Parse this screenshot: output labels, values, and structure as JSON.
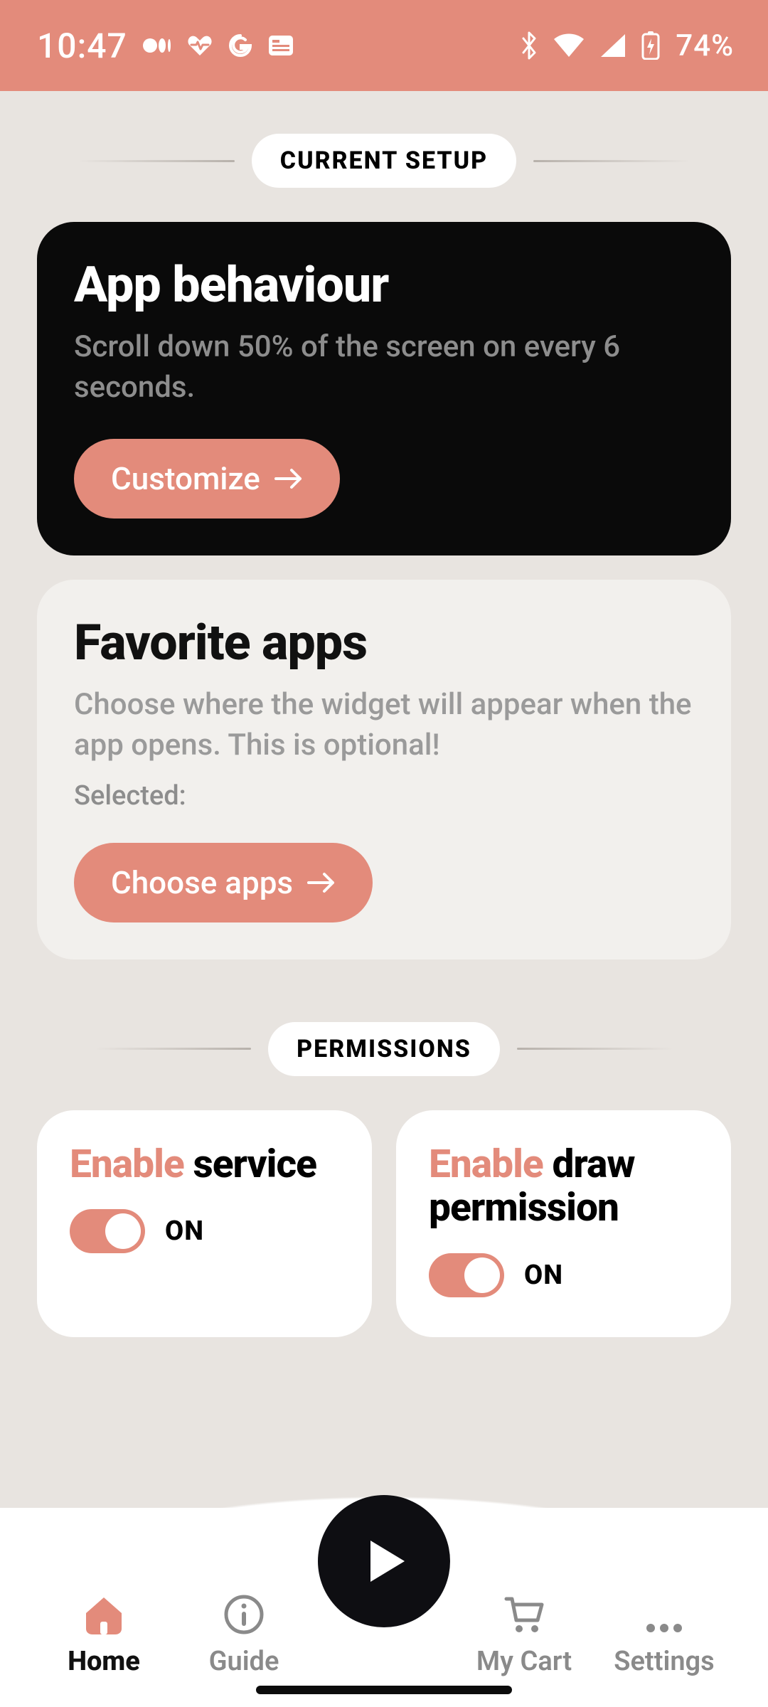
{
  "colors": {
    "accent": "#e38b7b"
  },
  "status_bar": {
    "time": "10:47",
    "battery": "74%"
  },
  "sections": {
    "setup_label": "CURRENT SETUP",
    "permissions_label": "PERMISSIONS"
  },
  "behaviour": {
    "title": "App behaviour",
    "subtitle": "Scroll down 50% of the screen on every 6 seconds.",
    "button": "Customize"
  },
  "favorite": {
    "title": "Favorite apps",
    "subtitle": "Choose where the widget will appear when the app opens. This is optional!",
    "selected_label": "Selected:",
    "button": "Choose apps"
  },
  "permissions": {
    "service": {
      "prefix": "Enable",
      "rest": " service",
      "state": "ON"
    },
    "draw": {
      "prefix": "Enable",
      "rest": " draw permission",
      "state": "ON"
    }
  },
  "nav": {
    "home": "Home",
    "guide": "Guide",
    "cart": "My Cart",
    "settings": "Settings"
  }
}
